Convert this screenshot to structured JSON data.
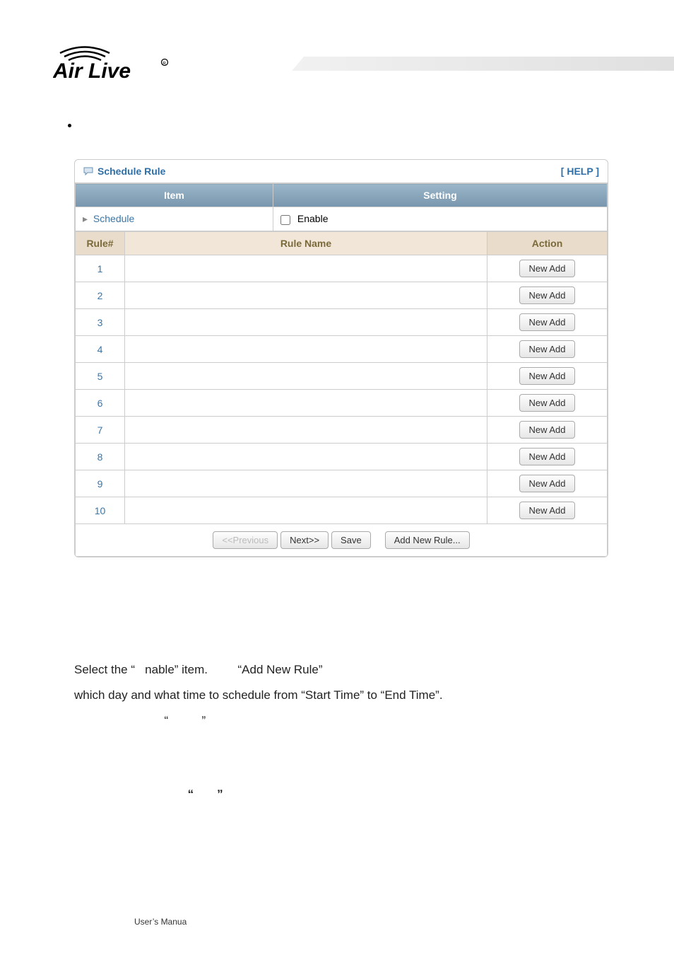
{
  "logo_alt": "Air Live",
  "panel": {
    "title": "Schedule Rule",
    "help": "[ HELP ]",
    "headers": {
      "item": "Item",
      "setting": "Setting"
    },
    "schedule_label": "Schedule",
    "enable_label": "Enable",
    "rule_headers": {
      "rule": "Rule#",
      "name": "Rule Name",
      "action": "Action"
    },
    "rows": [
      {
        "num": "1",
        "name": "",
        "btn": "New Add"
      },
      {
        "num": "2",
        "name": "",
        "btn": "New Add"
      },
      {
        "num": "3",
        "name": "",
        "btn": "New Add"
      },
      {
        "num": "4",
        "name": "",
        "btn": "New Add"
      },
      {
        "num": "5",
        "name": "",
        "btn": "New Add"
      },
      {
        "num": "6",
        "name": "",
        "btn": "New Add"
      },
      {
        "num": "7",
        "name": "",
        "btn": "New Add"
      },
      {
        "num": "8",
        "name": "",
        "btn": "New Add"
      },
      {
        "num": "9",
        "name": "",
        "btn": "New Add"
      },
      {
        "num": "10",
        "name": "",
        "btn": "New Add"
      }
    ],
    "buttons": {
      "prev": "<<Previous",
      "next": "Next>>",
      "save": "Save",
      "add": "Add New Rule..."
    }
  },
  "body": {
    "line1a": "Select the “",
    "line1b": "nable” item.",
    "line1c": "“Add New Rule”",
    "line2": "which day and what time to schedule from “Start Time” to “End Time”.",
    "line3a": "“",
    "line3b": "”",
    "line4a": "“",
    "line4b": "”"
  },
  "footer": "User’s Manua"
}
